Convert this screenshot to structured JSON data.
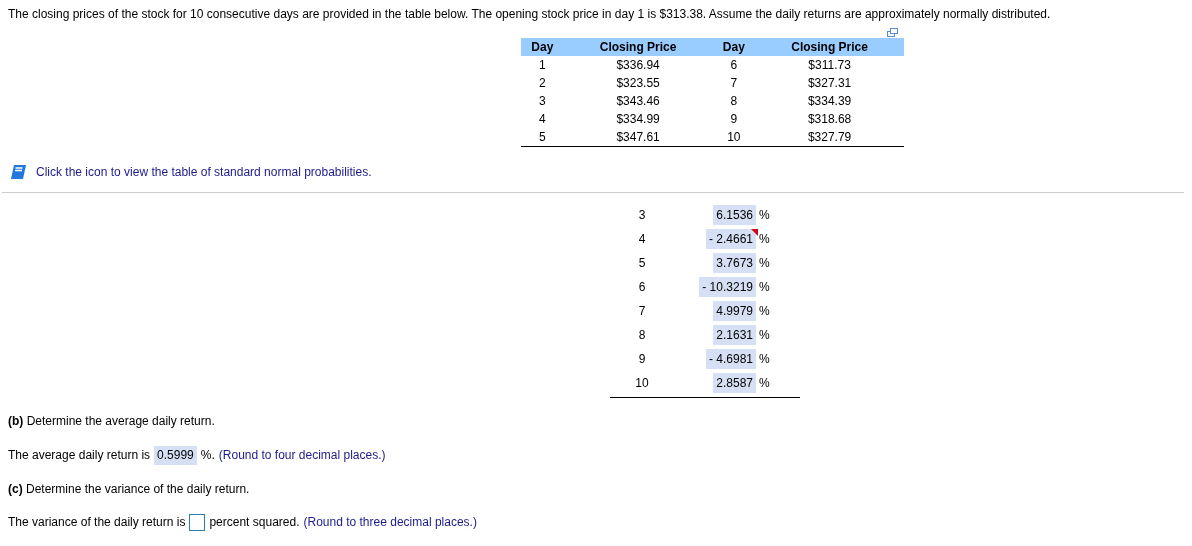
{
  "intro": "The closing prices of the stock for 10 consecutive days are provided in the table below. The opening stock price in day 1 is $313.38. Assume the daily returns are approximately normally distributed.",
  "price_table": {
    "columns": [
      "Day",
      "Closing Price",
      "Day",
      "Closing Price"
    ],
    "rows": [
      [
        "1",
        "$336.94",
        "6",
        "$311.73"
      ],
      [
        "2",
        "$323.55",
        "7",
        "$327.31"
      ],
      [
        "3",
        "$343.46",
        "8",
        "$334.39"
      ],
      [
        "4",
        "$334.99",
        "9",
        "$318.68"
      ],
      [
        "5",
        "$347.61",
        "10",
        "$327.79"
      ]
    ]
  },
  "table_link": "Click the icon to view the table of standard normal probabilities.",
  "returns": [
    {
      "day": "3",
      "value": "6.1536",
      "unit": "%",
      "flagged": false
    },
    {
      "day": "4",
      "value": "- 2.4661",
      "unit": "%",
      "flagged": true
    },
    {
      "day": "5",
      "value": "3.7673",
      "unit": "%",
      "flagged": false
    },
    {
      "day": "6",
      "value": "- 10.3219",
      "unit": "%",
      "flagged": false
    },
    {
      "day": "7",
      "value": "4.9979",
      "unit": "%",
      "flagged": false
    },
    {
      "day": "8",
      "value": "2.1631",
      "unit": "%",
      "flagged": false
    },
    {
      "day": "9",
      "value": "- 4.6981",
      "unit": "%",
      "flagged": false
    },
    {
      "day": "10",
      "value": "2.8587",
      "unit": "%",
      "flagged": false
    }
  ],
  "part_b": {
    "question": "**(b)** Determine the average daily return.",
    "before": "The average daily return is",
    "answer": "0.5999",
    "after": "%.",
    "hint": "(Round to four decimal places.)"
  },
  "part_c": {
    "question": "**(c)** Determine the variance of the daily return.",
    "before": "The variance of the daily return is",
    "after": "percent squared.",
    "hint": "(Round to three decimal places.)"
  }
}
